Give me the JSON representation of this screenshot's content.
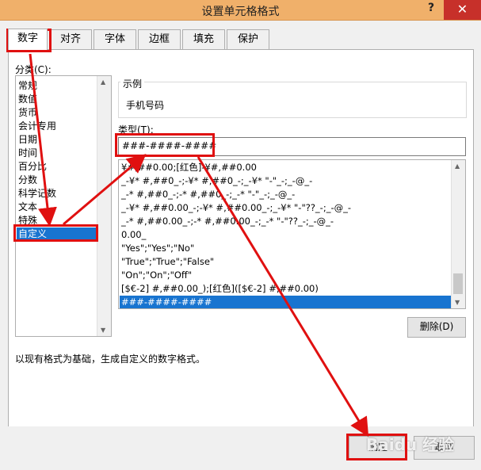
{
  "window": {
    "title": "设置单元格格式",
    "help": "?",
    "close": "✕"
  },
  "tabs": [
    "数字",
    "对齐",
    "字体",
    "边框",
    "填充",
    "保护"
  ],
  "category": {
    "label": "分类(C):",
    "items": [
      "常规",
      "数值",
      "货币",
      "会计专用",
      "日期",
      "时间",
      "百分比",
      "分数",
      "科学记数",
      "文本",
      "特殊",
      "自定义"
    ],
    "selected": "自定义"
  },
  "sample": {
    "title": "示例",
    "value": "手机号码"
  },
  "type": {
    "label": "类型(T):",
    "value": "###-####-####",
    "formats": [
      "¥#,##0.00;[红色]-¥#,##0.00",
      "_-¥* #,##0_-;-¥* #,##0_-;_-¥* \"-\"_-;_-@_-",
      "_-* #,##0_-;-* #,##0_-;_-* \"-\"_-;_-@_-",
      "_-¥* #,##0.00_-;-¥* #,##0.00_-;_-¥* \"-\"??_-;_-@_-",
      "_-* #,##0.00_-;-* #,##0.00_-;_-* \"-\"??_-;_-@_-",
      "0.00_",
      "\"Yes\";\"Yes\";\"No\"",
      "\"True\";\"True\";\"False\"",
      "\"On\";\"On\";\"Off\"",
      "[$€-2] #,##0.00_);[红色]([$€-2] #,##0.00)",
      "###-####-####"
    ],
    "selected": "###-####-####"
  },
  "delete_button": "删除(D)",
  "description": "以现有格式为基础，生成自定义的数字格式。",
  "ok_button": "确定",
  "cancel_button": "取消",
  "watermark": "Baidu 经验",
  "colors": {
    "accent": "#1874d0",
    "annotation": "#e01010",
    "title_bar": "#f0b06a",
    "close": "#c7302a"
  }
}
